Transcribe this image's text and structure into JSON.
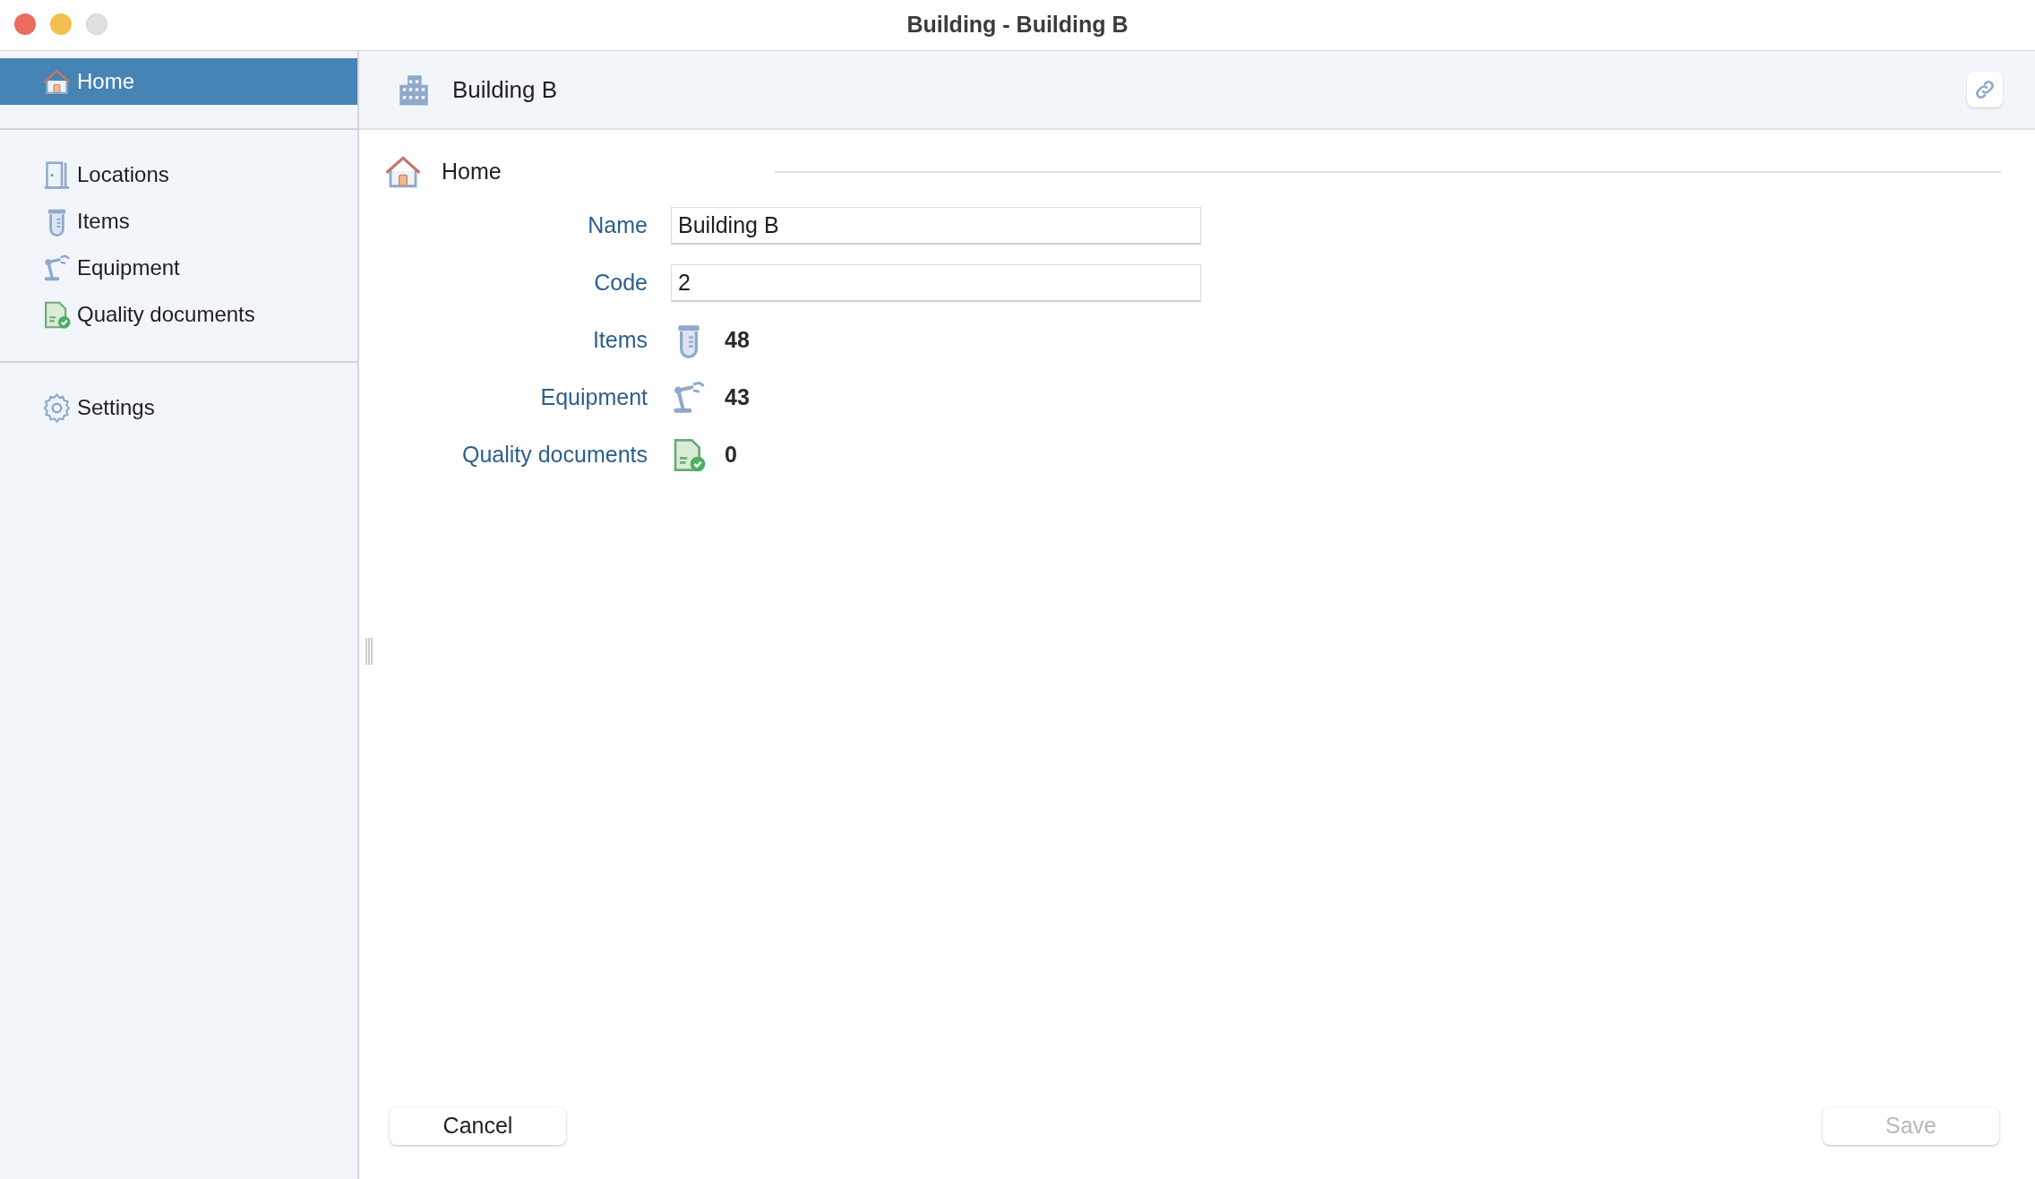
{
  "window": {
    "title": "Building - Building B"
  },
  "sidebar": {
    "groups": [
      {
        "items": [
          {
            "kind": "home",
            "label": "Home",
            "selected": true
          }
        ]
      },
      {
        "items": [
          {
            "kind": "door",
            "label": "Locations",
            "selected": false
          },
          {
            "kind": "tube",
            "label": "Items",
            "selected": false
          },
          {
            "kind": "arm",
            "label": "Equipment",
            "selected": false
          },
          {
            "kind": "document",
            "label": "Quality documents",
            "selected": false
          }
        ]
      },
      {
        "items": [
          {
            "kind": "gear",
            "label": "Settings",
            "selected": false
          }
        ]
      }
    ]
  },
  "header": {
    "title": "Building B"
  },
  "section": {
    "title": "Home"
  },
  "form": {
    "fields": [
      {
        "kind": "input",
        "label": "Name",
        "value": "Building B"
      },
      {
        "kind": "input",
        "label": "Code",
        "value": "2"
      },
      {
        "kind": "tube",
        "label": "Items",
        "value": "48"
      },
      {
        "kind": "arm",
        "label": "Equipment",
        "value": "43"
      },
      {
        "kind": "document",
        "label": "Quality documents",
        "value": "0"
      }
    ]
  },
  "buttons": [
    {
      "label": "Cancel",
      "disabled": false
    },
    {
      "label": "Save",
      "disabled": true
    }
  ]
}
